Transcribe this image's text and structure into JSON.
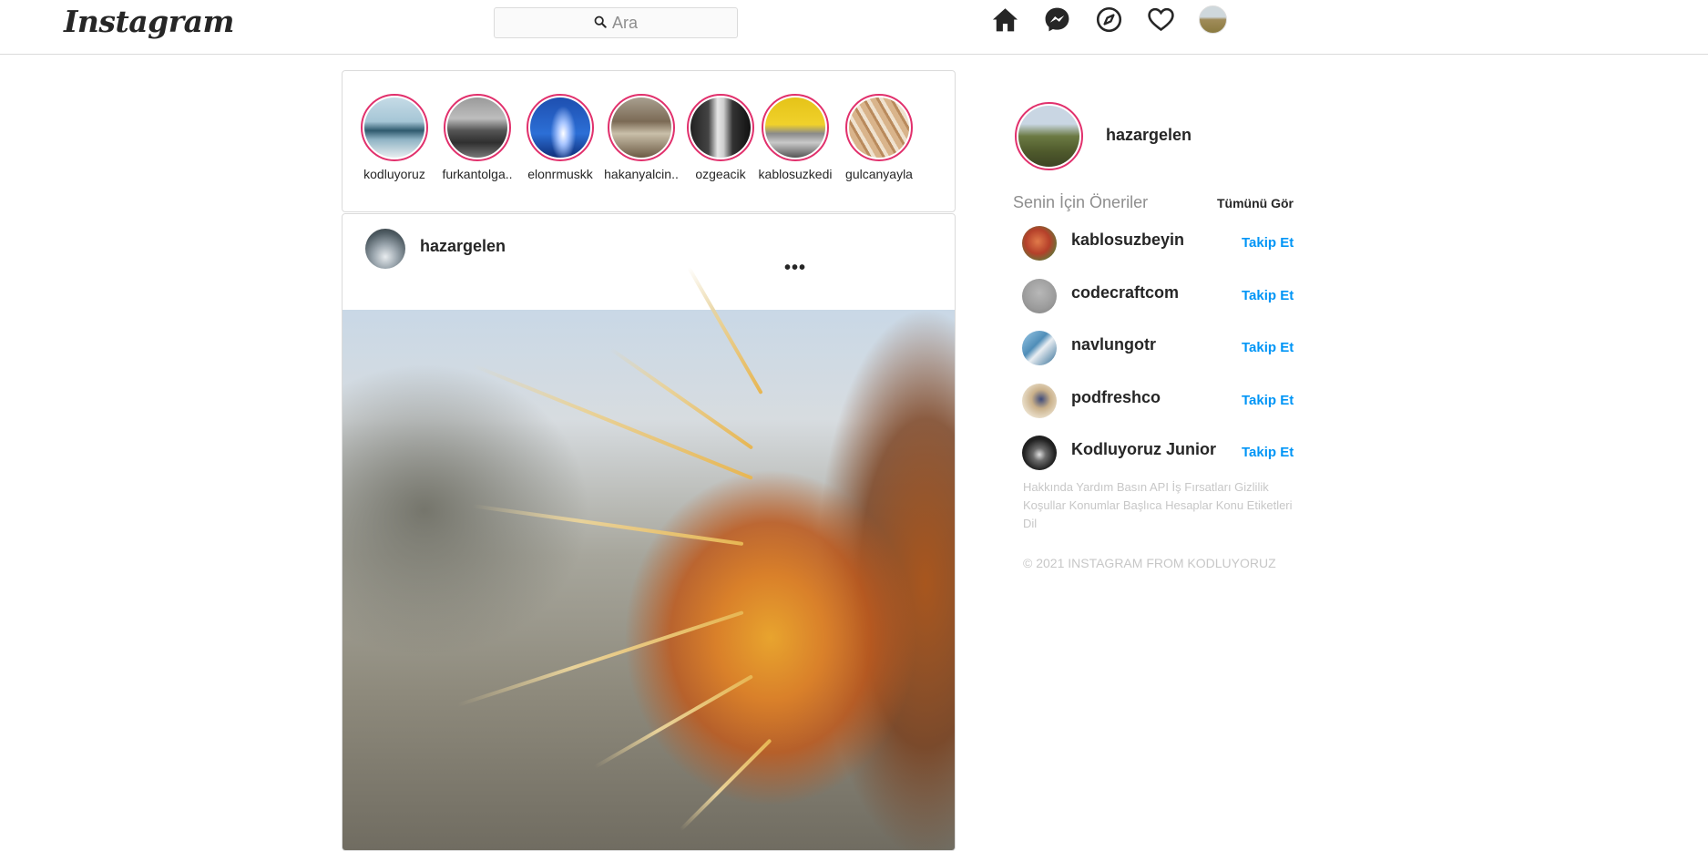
{
  "header": {
    "logo": "Instagram",
    "search_placeholder": "Ara"
  },
  "stories": [
    {
      "username": "kodluyoruz"
    },
    {
      "username": "furkantolga.."
    },
    {
      "username": "elonrmuskk"
    },
    {
      "username": "hakanyalcin.."
    },
    {
      "username": "ozgeacik"
    },
    {
      "username": "kablosuzkedi"
    },
    {
      "username": "gulcanyayla"
    }
  ],
  "post": {
    "username": "hazargelen",
    "more": "•••"
  },
  "sidebar": {
    "username": "hazargelen",
    "suggestions_title": "Senin İçin Öneriler",
    "see_all": "Tümünü Gör",
    "suggestions": [
      {
        "name": "kablosuzbeyin",
        "action": "Takip Et"
      },
      {
        "name": "codecraftcom",
        "action": "Takip Et"
      },
      {
        "name": "navlungotr",
        "action": "Takip Et"
      },
      {
        "name": "podfreshco",
        "action": "Takip Et"
      },
      {
        "name": "Kodluyoruz Junior",
        "action": "Takip Et"
      }
    ],
    "footer_links": "Hakkında Yardım Basın API İş Fırsatları Gizlilik Koşullar Konumlar Başlıca Hesaplar Konu Etiketleri Dil",
    "copyright": "© 2021 INSTAGRAM FROM KODLUYORUZ"
  }
}
